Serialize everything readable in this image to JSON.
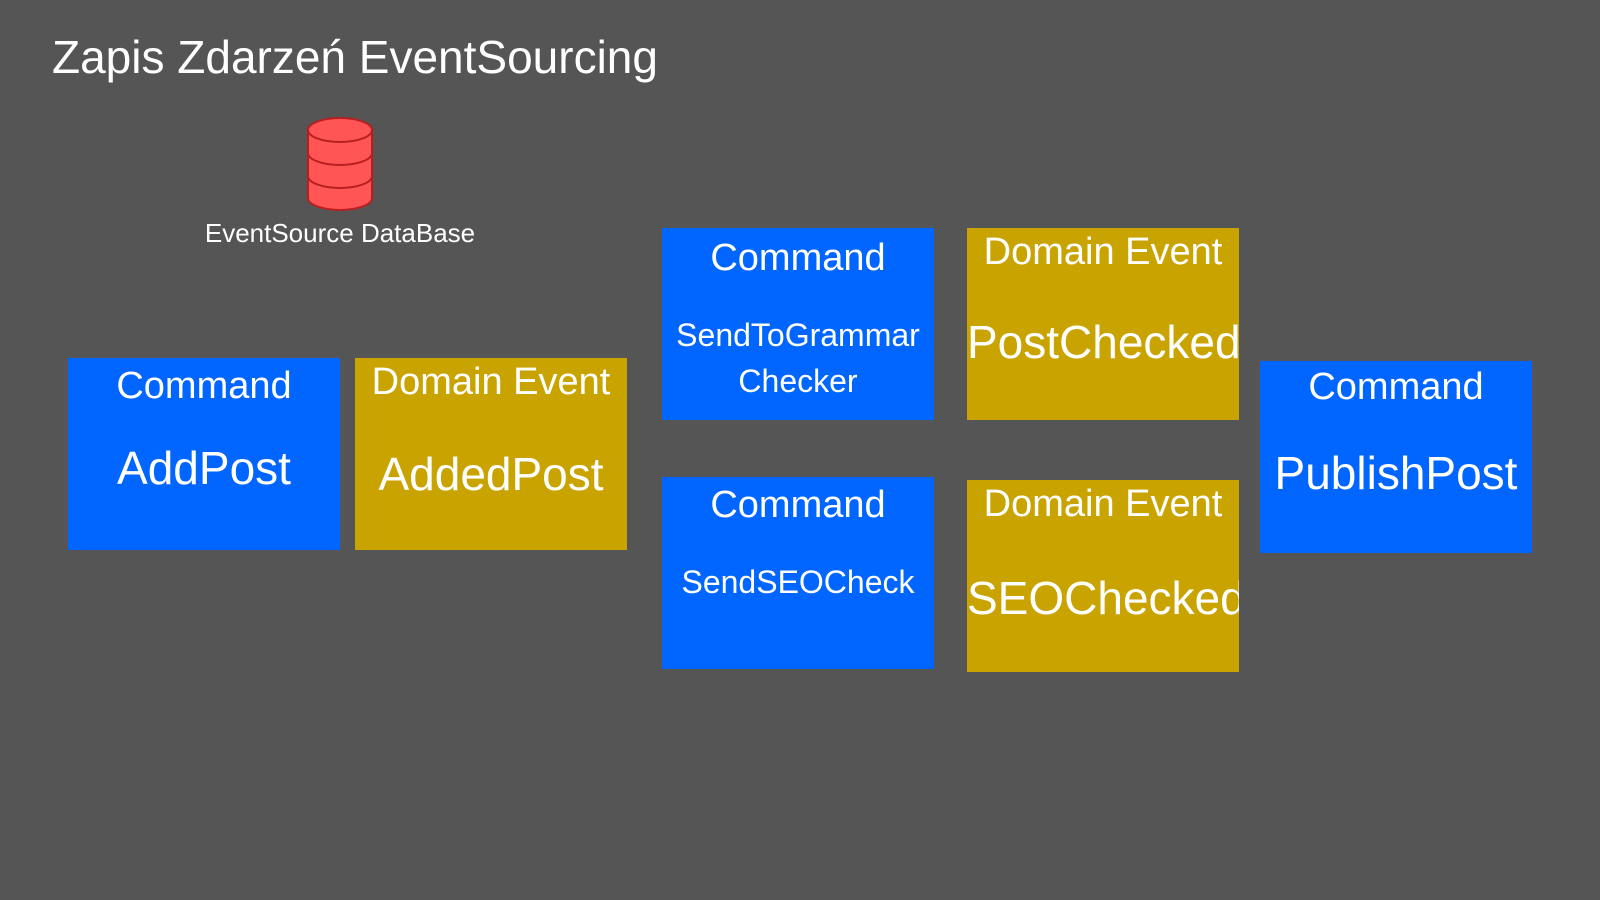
{
  "title": "Zapis Zdarzeń EventSourcing",
  "database": {
    "icon": "database-icon",
    "label": "EventSource DataBase",
    "color": "#ff5555"
  },
  "colors": {
    "background": "#555555",
    "command": "#0066ff",
    "event": "#c9a300"
  },
  "cards": {
    "add_post": {
      "kind": "Command",
      "name": "AddPost"
    },
    "added_post": {
      "kind": "Domain Event",
      "name": "AddedPost"
    },
    "send_grammar": {
      "kind": "Command",
      "name_line1": "SendToGrammar",
      "name_line2": "Checker"
    },
    "post_checked": {
      "kind": "Domain Event",
      "name": "PostChecked"
    },
    "send_seo": {
      "kind": "Command",
      "name": "SendSEOCheck"
    },
    "seo_checked": {
      "kind": "Domain Event",
      "name": "SEOChecked"
    },
    "publish_post": {
      "kind": "Command",
      "name": "PublishPost"
    }
  }
}
